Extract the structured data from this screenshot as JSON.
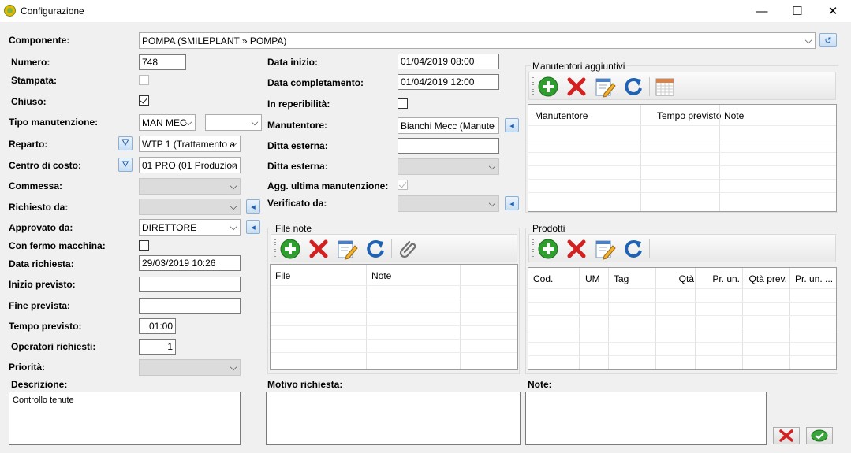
{
  "window": {
    "title": "Configurazione",
    "minimize": "—",
    "maximize": "☐",
    "close": "✕"
  },
  "form": {
    "componente": {
      "label": "Componente:",
      "value": "POMPA (SMILEPLANT » POMPA)"
    },
    "numero": {
      "label": "Numero:",
      "value": "748"
    },
    "stampata": {
      "label": "Stampata:",
      "checked": false
    },
    "chiuso": {
      "label": "Chiuso:",
      "checked": true
    },
    "tipo_manutenzione": {
      "label": "Tipo manutenzione:",
      "value": "MAN MEC",
      "value2": ""
    },
    "reparto": {
      "label": "Reparto:",
      "value": "WTP 1 (Trattamento a"
    },
    "centro_di_costo": {
      "label": "Centro di costo:",
      "value": "01 PRO (01 Produzion"
    },
    "commessa": {
      "label": "Commessa:",
      "value": ""
    },
    "richiesto_da": {
      "label": "Richiesto da:",
      "value": ""
    },
    "approvato_da": {
      "label": "Approvato da:",
      "value": "DIRETTORE"
    },
    "con_fermo_macchina": {
      "label": "Con fermo macchina:",
      "checked": false
    },
    "data_richiesta": {
      "label": "Data richiesta:",
      "value": "29/03/2019 10:26"
    },
    "inizio_previsto": {
      "label": "Inizio previsto:",
      "value": ""
    },
    "fine_prevista": {
      "label": "Fine prevista:",
      "value": ""
    },
    "tempo_previsto": {
      "label": "Tempo previsto:",
      "value": "01:00"
    },
    "operatori_richiesti": {
      "label": "Operatori richiesti:",
      "value": "1"
    },
    "priorita": {
      "label": "Priorità:",
      "value": ""
    },
    "descrizione": {
      "label": "Descrizione:",
      "value": "Controllo tenute"
    },
    "data_inizio": {
      "label": "Data inizio:",
      "value": "01/04/2019 08:00"
    },
    "data_completamento": {
      "label": "Data completamento:",
      "value": "01/04/2019 12:00"
    },
    "in_reperibilita": {
      "label": "In reperibilità:",
      "checked": false
    },
    "manutentore": {
      "label": "Manutentore:",
      "value": "Bianchi Mecc (Manute"
    },
    "ditta_esterna_text": {
      "label": "Ditta esterna:",
      "value": ""
    },
    "ditta_esterna_combo": {
      "label": "Ditta esterna:",
      "value": ""
    },
    "agg_ultima": {
      "label": "Agg. ultima manutenzione:",
      "checked": true
    },
    "verificato_da": {
      "label": "Verificato da:",
      "value": ""
    },
    "motivo_richiesta": {
      "label": "Motivo richiesta:",
      "value": ""
    },
    "note": {
      "label": "Note:",
      "value": ""
    }
  },
  "file_note": {
    "title": "File note",
    "columns": [
      "File",
      "Note",
      ""
    ]
  },
  "manutentori": {
    "title": "Manutentori aggiuntivi",
    "columns": [
      "Manutentore",
      "Tempo previsto",
      "Note"
    ]
  },
  "prodotti": {
    "title": "Prodotti",
    "columns": [
      "Cod.",
      "UM",
      "Tag",
      "Qtà",
      "Pr. un.",
      "Qtà prev.",
      "Pr. un. ..."
    ]
  },
  "icons": {
    "add": "add-icon",
    "delete": "delete-icon",
    "edit": "edit-icon",
    "refresh": "refresh-icon",
    "attach": "paperclip-icon",
    "calendar": "calendar-icon",
    "filter": "filter-icon",
    "back": "arrow-left-icon"
  },
  "colors": {
    "add_green": "#2e9e2e",
    "delete_red": "#d32020",
    "refresh_blue": "#1f62b4",
    "window_bg": "#f0f0f0"
  }
}
